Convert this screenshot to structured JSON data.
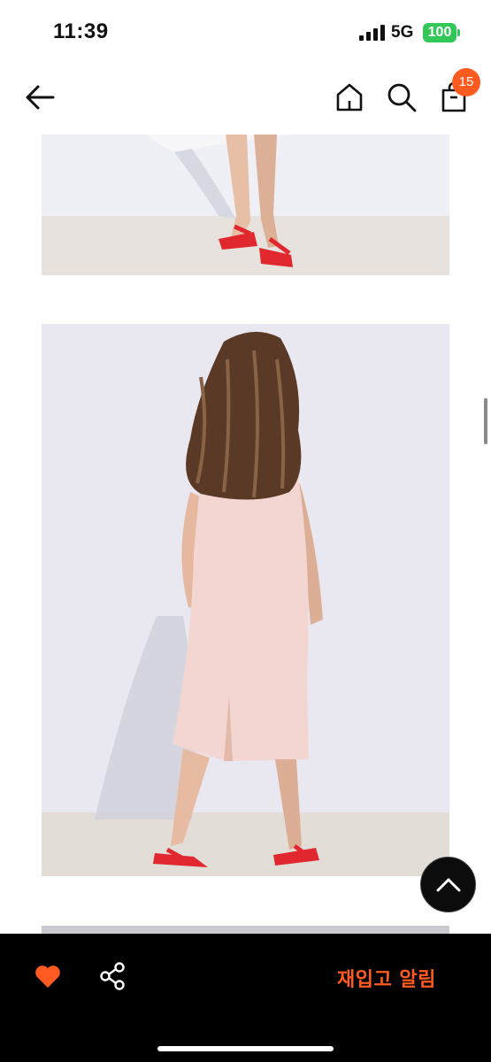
{
  "status_bar": {
    "time": "11:39",
    "network": "5G",
    "battery": "100"
  },
  "header": {
    "icons": [
      "back-arrow-icon",
      "home-icon",
      "search-icon",
      "shopping-bag-icon"
    ],
    "cart_count": "15"
  },
  "images": [
    {
      "name": "product-image-sandals-closeup"
    },
    {
      "name": "product-image-back-view-dress"
    },
    {
      "name": "product-image-next"
    }
  ],
  "bottom_bar": {
    "restock_label": "재입고 알림",
    "icons": [
      "heart-icon",
      "share-icon"
    ]
  },
  "colors": {
    "accent": "#ff5a1f",
    "bottom_bar": "#000000",
    "battery": "#33c759",
    "sandal_red": "#e0282e",
    "dress_pink": "#f3d6d2"
  }
}
